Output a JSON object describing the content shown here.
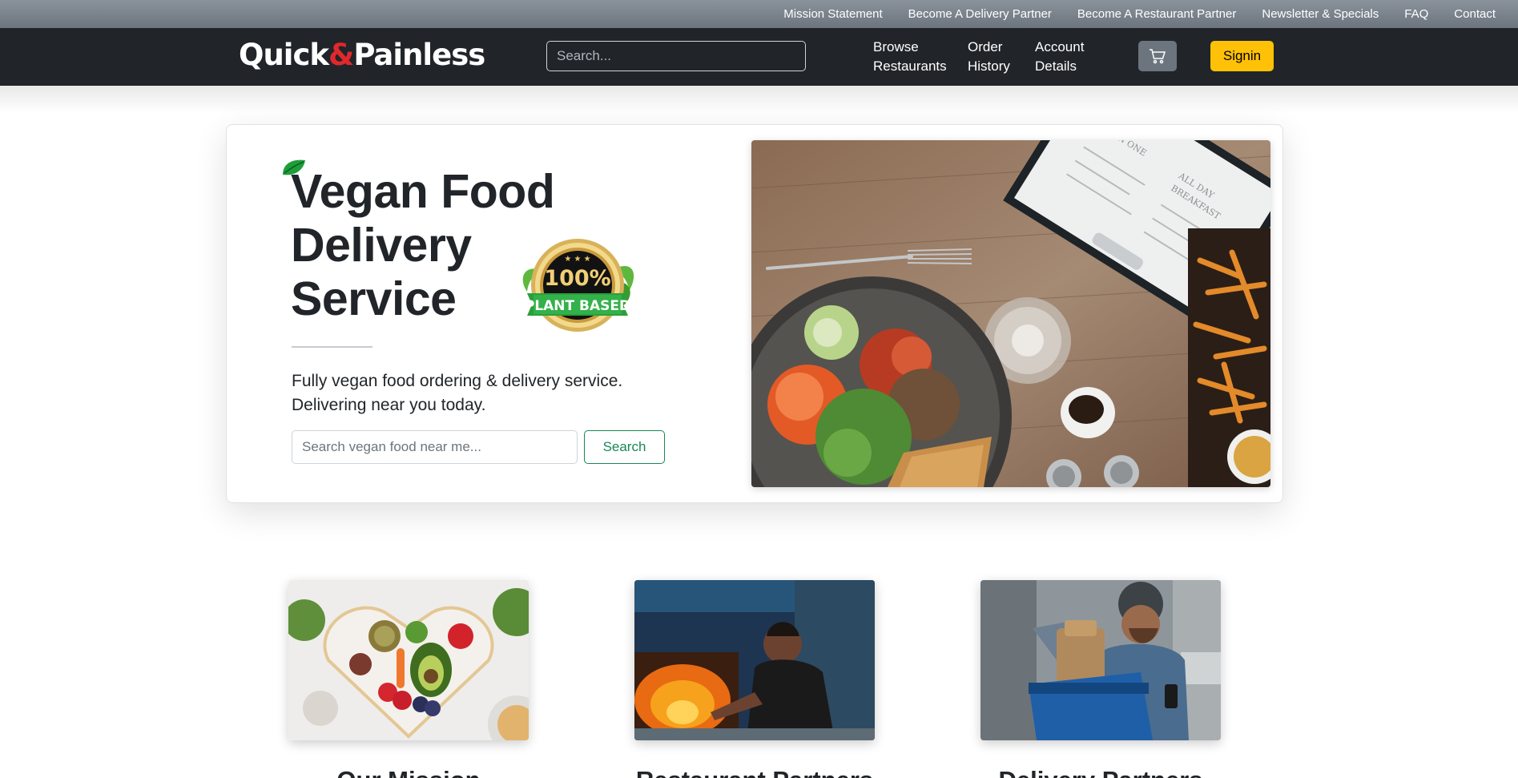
{
  "topbar": {
    "links": [
      "Mission Statement",
      "Become A Delivery Partner",
      "Become A Restaurant Partner",
      "Newsletter & Specials",
      "FAQ",
      "Contact"
    ]
  },
  "navbar": {
    "brand_part1": "Quick",
    "brand_amp": "&",
    "brand_part2": "Painless",
    "search_placeholder": "Search...",
    "browse_line1": "Browse",
    "browse_line2": "Restaurants",
    "orders_line1": "Order",
    "orders_line2": "History",
    "account_line1": "Account",
    "account_line2": "Details",
    "cart_icon": "cart-icon",
    "signin_label": "Signin"
  },
  "hero": {
    "title_line1": "Vegan Food",
    "title_line2": "Delivery",
    "title_line3": "Service",
    "badge_top": "100%",
    "badge_bottom": "PLANT BASED",
    "subtitle_line1": "Fully vegan food ordering & delivery service.",
    "subtitle_line2": "Delivering near you today.",
    "search_placeholder": "Search vegan food near me...",
    "search_button": "Search",
    "photo_menu_lines": [
      "ALL IN ONE",
      "ALL DAY",
      "BREAKFAST"
    ]
  },
  "features": [
    {
      "title": "Our Mission"
    },
    {
      "title": "Restaurant Partners"
    },
    {
      "title": "Delivery Partners"
    }
  ],
  "colors": {
    "brand_red": "#e0282d",
    "signin_yellow": "#ffc107",
    "search_green": "#198754",
    "navbar_dark": "#212529"
  }
}
